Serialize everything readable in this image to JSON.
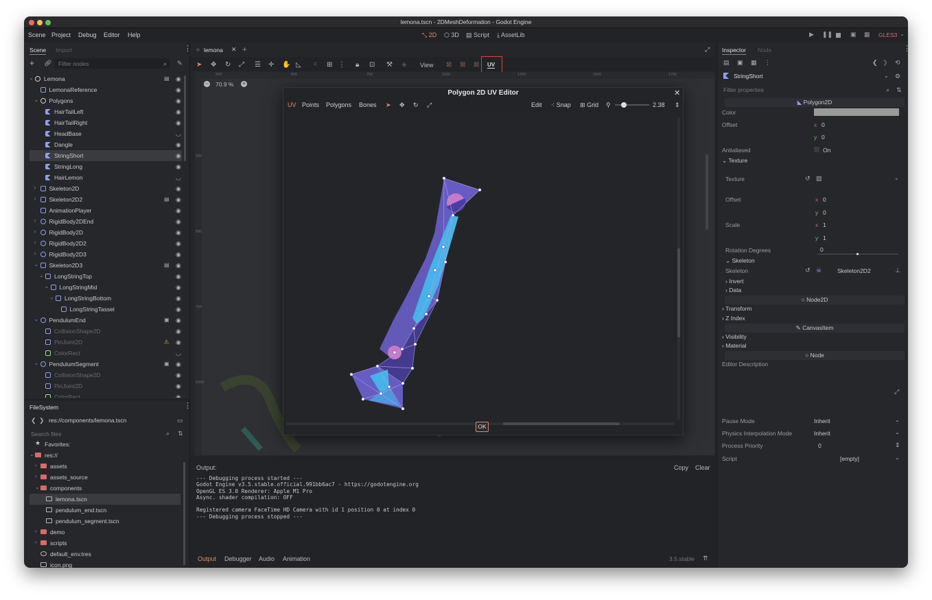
{
  "window": {
    "title": "lemona.tscn - 2DMeshDeformation - Godot Engine"
  },
  "menu": [
    "Scene",
    "Project",
    "Debug",
    "Editor",
    "Help"
  ],
  "workspaces": [
    {
      "label": "2D",
      "active": true
    },
    {
      "label": "3D",
      "active": false
    },
    {
      "label": "Script",
      "active": false
    },
    {
      "label": "AssetLib",
      "active": false
    }
  ],
  "renderer": "GLES3",
  "scene_dock": {
    "tabs": [
      "Scene",
      "Import"
    ],
    "filter_placeholder": "Filter nodes",
    "nodes": [
      {
        "label": "Lemona",
        "indent": 0,
        "icon": "node2d-icon",
        "color": "#cfcfcf",
        "arrow": "v",
        "extra": "script-icon"
      },
      {
        "label": "LemonaReference",
        "indent": 1,
        "icon": "sprite-icon",
        "color": "#8fa0ea"
      },
      {
        "label": "Polygons",
        "indent": 1,
        "icon": "node2d-icon",
        "color": "#cfcfcf",
        "arrow": "v"
      },
      {
        "label": "HairTailLeft",
        "indent": 2,
        "icon": "polygon-icon",
        "color": "#8fa0ea"
      },
      {
        "label": "HairTailRight",
        "indent": 2,
        "icon": "polygon-icon",
        "color": "#8fa0ea"
      },
      {
        "label": "HeadBase",
        "indent": 2,
        "icon": "polygon-icon",
        "color": "#8fa0ea",
        "hidden": true
      },
      {
        "label": "Dangle",
        "indent": 2,
        "icon": "polygon-icon",
        "color": "#8fa0ea"
      },
      {
        "label": "StringShort",
        "indent": 2,
        "icon": "polygon-icon",
        "color": "#8fa0ea",
        "selected": true
      },
      {
        "label": "StringLong",
        "indent": 2,
        "icon": "polygon-icon",
        "color": "#8fa0ea"
      },
      {
        "label": "HairLemon",
        "indent": 2,
        "icon": "polygon-icon",
        "color": "#8fa0ea",
        "hidden": true
      },
      {
        "label": "Skeleton2D",
        "indent": 1,
        "icon": "skeleton-icon",
        "color": "#8fa0ea",
        "arrow": ">"
      },
      {
        "label": "Skeleton2D2",
        "indent": 1,
        "icon": "skeleton-icon",
        "color": "#8fa0ea",
        "arrow": ">",
        "extra": "script-icon"
      },
      {
        "label": "AnimationPlayer",
        "indent": 1,
        "icon": "animation-icon",
        "color": "#8fa0ea"
      },
      {
        "label": "RigidBody2DEnd",
        "indent": 1,
        "icon": "rigidbody-icon",
        "color": "#8fa0ea",
        "arrow": ">"
      },
      {
        "label": "RigidBody2D",
        "indent": 1,
        "icon": "rigidbody-icon",
        "color": "#8fa0ea",
        "arrow": ">"
      },
      {
        "label": "RigidBody2D2",
        "indent": 1,
        "icon": "rigidbody-icon",
        "color": "#8fa0ea",
        "arrow": ">"
      },
      {
        "label": "RigidBody2D3",
        "indent": 1,
        "icon": "rigidbody-icon",
        "color": "#8fa0ea",
        "arrow": ">"
      },
      {
        "label": "Skeleton2D3",
        "indent": 1,
        "icon": "skeleton-icon",
        "color": "#8fa0ea",
        "arrow": "v",
        "extra": "script-icon"
      },
      {
        "label": "LongStringTop",
        "indent": 2,
        "icon": "bone-icon",
        "color": "#8fa0ea",
        "arrow": "v"
      },
      {
        "label": "LongStringMid",
        "indent": 3,
        "icon": "bone-icon",
        "color": "#8fa0ea",
        "arrow": "v"
      },
      {
        "label": "LongStringBottom",
        "indent": 4,
        "icon": "bone-icon",
        "color": "#8fa0ea",
        "arrow": "v"
      },
      {
        "label": "LongStringTassel",
        "indent": 5,
        "icon": "bone-icon",
        "color": "#8fa0ea"
      },
      {
        "label": "PendulumEnd",
        "indent": 1,
        "icon": "rigidbody-icon",
        "color": "#8fa0ea",
        "arrow": "v",
        "extra": "scene-icon"
      },
      {
        "label": "CollisionShape2D",
        "indent": 2,
        "icon": "collision-icon",
        "color": "#8fa0ea",
        "dim": true
      },
      {
        "label": "PinJoint2D",
        "indent": 2,
        "icon": "pin-icon",
        "color": "#8fa0ea",
        "dim": true,
        "extra": "warning-icon"
      },
      {
        "label": "ColorRect",
        "indent": 2,
        "icon": "colorrect-icon",
        "color": "#8eea8e",
        "dim": true,
        "hidden": true
      },
      {
        "label": "PendulumSegment",
        "indent": 1,
        "icon": "rigidbody-icon",
        "color": "#8fa0ea",
        "arrow": "v",
        "extra": "scene-icon"
      },
      {
        "label": "CollisionShape2D",
        "indent": 2,
        "icon": "collision-icon",
        "color": "#8fa0ea",
        "dim": true
      },
      {
        "label": "PinJoint2D",
        "indent": 2,
        "icon": "pin-icon",
        "color": "#8fa0ea",
        "dim": true
      },
      {
        "label": "ColorRect",
        "indent": 2,
        "icon": "colorrect-icon",
        "color": "#8eea8e",
        "dim": true
      }
    ]
  },
  "filesystem": {
    "title": "FileSystem",
    "path": "res://components/lemona.tscn",
    "search_placeholder": "Search files",
    "items": [
      {
        "label": "Favorites:",
        "indent": 0,
        "type": "star",
        "color": "#c8c8c8"
      },
      {
        "label": "res://",
        "indent": 0,
        "type": "folder",
        "color": "#d96a6a",
        "arrow": "v"
      },
      {
        "label": "assets",
        "indent": 1,
        "type": "folder",
        "color": "#d96a6a",
        "arrow": ">"
      },
      {
        "label": "assets_source",
        "indent": 1,
        "type": "folder",
        "color": "#d96a6a",
        "arrow": ">"
      },
      {
        "label": "components",
        "indent": 1,
        "type": "folder",
        "color": "#d96a6a",
        "arrow": "v"
      },
      {
        "label": "lemona.tscn",
        "indent": 2,
        "type": "scene",
        "color": "#b9b9b9",
        "selected": true
      },
      {
        "label": "pendulum_end.tscn",
        "indent": 2,
        "type": "scene",
        "color": "#b9b9b9"
      },
      {
        "label": "pendulum_segment.tscn",
        "indent": 2,
        "type": "scene",
        "color": "#b9b9b9"
      },
      {
        "label": "demo",
        "indent": 1,
        "type": "folder",
        "color": "#d96a6a",
        "arrow": ">"
      },
      {
        "label": "scripts",
        "indent": 1,
        "type": "folder",
        "color": "#d96a6a",
        "arrow": ">"
      },
      {
        "label": "default_env.tres",
        "indent": 1,
        "type": "globe",
        "color": "#b9b9b9"
      },
      {
        "label": "icon.png",
        "indent": 1,
        "type": "image",
        "color": "#b9b9b9"
      }
    ]
  },
  "editor": {
    "scene_tab": "lemona",
    "view_label": "View",
    "uv_label": "UV",
    "zoom": "70.9 %",
    "ruler_marks": [
      "250",
      "500",
      "750",
      "1000",
      "1250",
      "1500",
      "1750"
    ],
    "ruler_v_marks": [
      "250",
      "500",
      "750",
      "1000"
    ]
  },
  "uv_editor": {
    "title": "Polygon 2D UV Editor",
    "modes": [
      {
        "label": "UV",
        "active": true
      },
      {
        "label": "Points",
        "active": false
      },
      {
        "label": "Polygons",
        "active": false
      },
      {
        "label": "Bones",
        "active": false
      }
    ],
    "edit_label": "Edit",
    "snap_label": "Snap",
    "grid_label": "Grid",
    "zoom_value": "2.38",
    "ok_label": "OK"
  },
  "output": {
    "label": "Output:",
    "copy_label": "Copy",
    "clear_label": "Clear",
    "lines": [
      "--- Debugging process started ---",
      "Godot Engine v3.5.stable.official.991bb6ac7 - https://godotengine.org",
      "OpenGL ES 3.0 Renderer: Apple M1 Pro",
      "Async. shader compilation: OFF",
      "",
      "Registered camera FaceTime HD Camera with id 1 position 0 at index 0",
      "--- Debugging process stopped ---"
    ],
    "tabs": [
      {
        "label": "Output",
        "active": true
      },
      {
        "label": "Debugger",
        "active": false
      },
      {
        "label": "Audio",
        "active": false
      },
      {
        "label": "Animation",
        "active": false
      }
    ],
    "version": "3.5.stable"
  },
  "inspector": {
    "tabs": [
      "Inspector",
      "Node"
    ],
    "object_name": "StringShort",
    "filter_placeholder": "Filter properties",
    "class_header": "Polygon2D",
    "color_label": "Color",
    "color_value": "#9a9a9a",
    "offset_label": "Offset",
    "offset_x": "0",
    "offset_y": "0",
    "antialiased_label": "Antialiased",
    "antialiased_value": "On",
    "texture_group": "Texture",
    "texture_label": "Texture",
    "tex_offset_label": "Offset",
    "tex_offset_x": "0",
    "tex_offset_y": "0",
    "scale_label": "Scale",
    "scale_x": "1",
    "scale_y": "1",
    "rotation_label": "Rotation Degrees",
    "rotation_value": "0",
    "skeleton_group": "Skeleton",
    "skeleton_label": "Skeleton",
    "skeleton_value": "Skeleton2D2",
    "invert_label": "Invert",
    "data_label": "Data",
    "node2d_header": "Node2D",
    "transform_label": "Transform",
    "zindex_label": "Z Index",
    "canvasitem_header": "CanvasItem",
    "visibility_label": "Visibility",
    "material_label": "Material",
    "node_header": "Node",
    "editor_desc_label": "Editor Description",
    "pause_mode_label": "Pause Mode",
    "pause_mode_value": "Inherit",
    "physics_interp_label": "Physics Interpolation Mode",
    "physics_interp_value": "Inherit",
    "process_priority_label": "Process Priority",
    "process_priority_value": "0",
    "script_label": "Script",
    "script_value": "[empty]"
  },
  "colors": {
    "accent": "#e28a6a",
    "highlight_box": "#e0413a",
    "mesh_fill": "#6a5fc9",
    "mesh_dark": "#4a3fa0",
    "bone_fill": "#47b2e8",
    "joint_fill": "#c67ac9"
  }
}
